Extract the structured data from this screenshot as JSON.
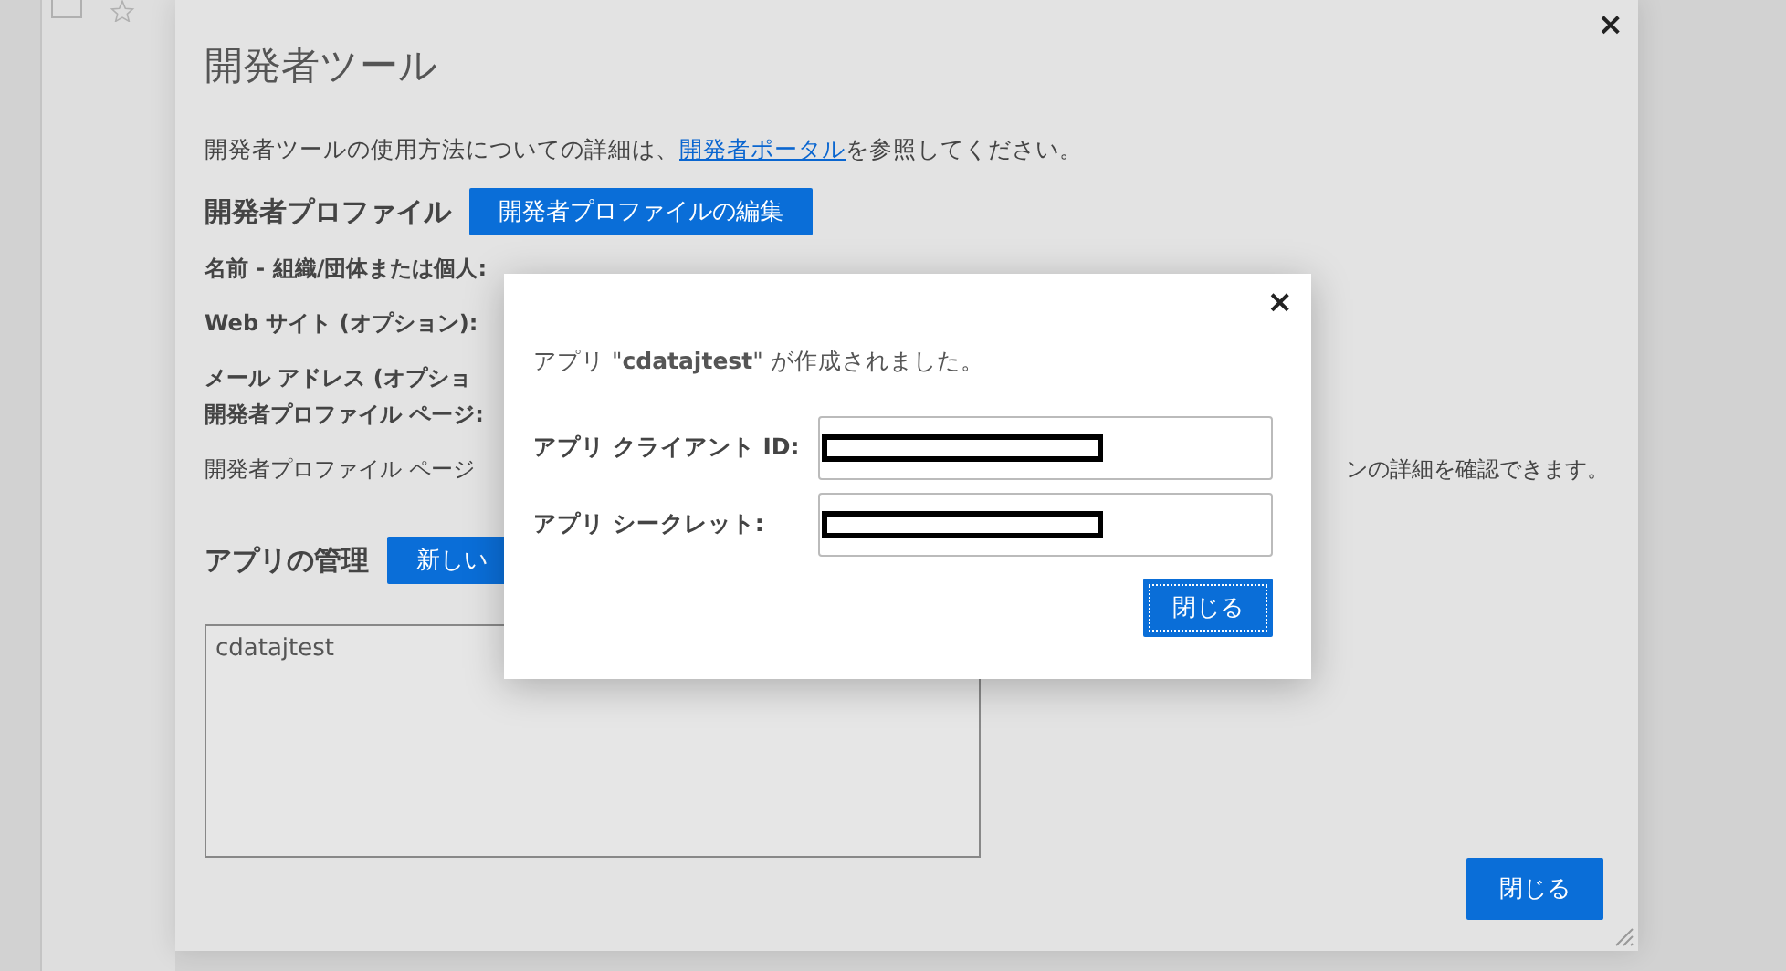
{
  "page": {
    "checkbox_checked": false
  },
  "dialog": {
    "title": "開発者ツール",
    "close": "×",
    "intro": {
      "before": "開発者ツールの使用方法についての詳細は、",
      "link": "開発者ポータル",
      "after": "を参照してください。"
    },
    "profile": {
      "heading": "開発者プロファイル",
      "edit_button": "開発者プロファイルの編集",
      "fields": [
        {
          "label": "名前 - 組織/団体または個人:"
        },
        {
          "label": "Web サイト (オプション):"
        },
        {
          "label": "メール アドレス (オプショ"
        },
        {
          "label": "開発者プロファイル ページ:"
        }
      ],
      "page_note": {
        "left": "開発者プロファイル ページ",
        "right": "ンの詳細を確認できます。"
      }
    },
    "apps": {
      "heading": "アプリの管理",
      "new_button": "新しい",
      "items": [
        {
          "name": "cdatajtest",
          "selected": false
        }
      ]
    },
    "close_button": "閉じる"
  },
  "modal": {
    "close": "×",
    "message": "アプリ \"**cdatajtest**\" が作成されました。",
    "fields": [
      {
        "label": "アプリ クライアント ID:",
        "redacted": true
      },
      {
        "label": "アプリ シークレット:",
        "redacted": true
      }
    ],
    "close_button": "閉じる",
    "close_focused": true
  }
}
